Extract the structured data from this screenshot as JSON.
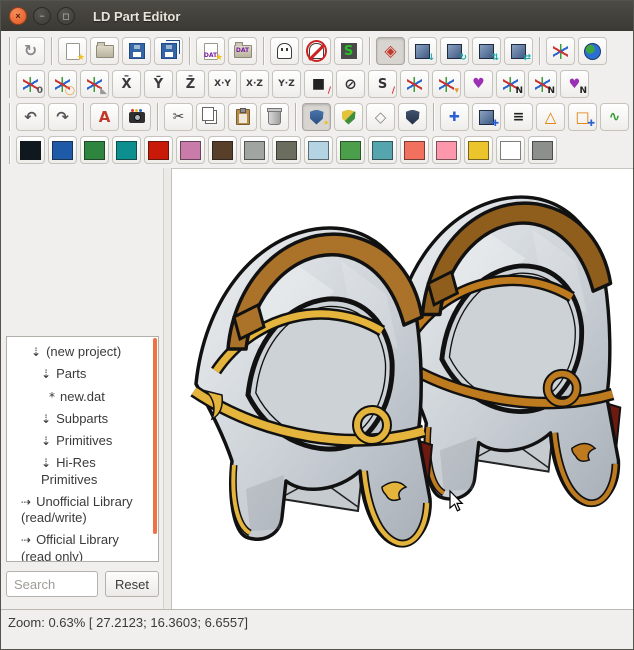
{
  "window": {
    "title": "LD Part Editor",
    "controls": [
      {
        "name": "close",
        "glyph": "×"
      },
      {
        "name": "minimize",
        "glyph": "−"
      },
      {
        "name": "maximize",
        "glyph": "◻"
      }
    ]
  },
  "toolbars": {
    "rows": [
      {
        "name": "toolbar-row-file",
        "items": [
          {
            "sep": true
          },
          {
            "name": "sync",
            "glyph": "↻",
            "color": "#8a8a8a",
            "size": 16
          },
          {
            "sep": true
          },
          {
            "name": "new-project",
            "kind": "page",
            "badge": "★",
            "badge_color": "#f0c020"
          },
          {
            "name": "open-project",
            "kind": "folder"
          },
          {
            "name": "save",
            "kind": "floppy"
          },
          {
            "name": "save-all",
            "kind": "floppy2"
          },
          {
            "sep": true
          },
          {
            "name": "new-dat-file",
            "kind": "page",
            "glyph": "DAT",
            "badge": "★",
            "badge_color": "#f0c020"
          },
          {
            "name": "open-dat-file",
            "kind": "folder",
            "glyph": "DAT"
          },
          {
            "sep": true
          },
          {
            "name": "show-ghost",
            "kind": "ghost"
          },
          {
            "name": "hide-ghost",
            "kind": "ghostno"
          },
          {
            "name": "swap-winding",
            "kind": "smode",
            "glyph": "S"
          },
          {
            "sep": true
          },
          {
            "name": "select-mode",
            "glyph": "◈",
            "color": "#c0392b",
            "size": 16,
            "pressed": true
          },
          {
            "name": "move-mode",
            "kind": "cube",
            "badge": "↓",
            "badge_color": "#18a8a8"
          },
          {
            "name": "rotate-mode",
            "kind": "cube",
            "badge": "↻",
            "badge_color": "#18a8a8"
          },
          {
            "name": "scale-mode",
            "kind": "cube",
            "badge": "⇅",
            "badge_color": "#18a8a8"
          },
          {
            "name": "combined-mode",
            "kind": "cube",
            "badge": "⇄",
            "badge_color": "#18a8a8"
          },
          {
            "sep": true
          },
          {
            "name": "local-axes",
            "kind": "axes3"
          },
          {
            "name": "global-axes",
            "kind": "globe"
          }
        ]
      },
      {
        "name": "toolbar-row-manipulator",
        "items": [
          {
            "sep": true
          },
          {
            "name": "manipulator-to-origin",
            "kind": "axes3",
            "badge": "0",
            "badge_color": "#555"
          },
          {
            "name": "manipulator-to-world",
            "kind": "axes3",
            "badge": "◯",
            "badge_color": "#e8912a"
          },
          {
            "name": "manipulator-to-surface",
            "kind": "axes3",
            "badge": "◣",
            "badge_color": "#9a9a9a"
          },
          {
            "name": "manipulator-x",
            "glyph": "X̄",
            "color": "#3a3a3a",
            "size": 13
          },
          {
            "name": "manipulator-y",
            "glyph": "Ȳ",
            "color": "#3a3a3a",
            "size": 13
          },
          {
            "name": "manipulator-z",
            "glyph": "Z̄",
            "color": "#3a3a3a",
            "size": 13
          },
          {
            "name": "manipulator-xy",
            "glyph": "X·Y",
            "color": "#3a3a3a",
            "size": 9
          },
          {
            "name": "manipulator-xz",
            "glyph": "X·Z",
            "color": "#3a3a3a",
            "size": 9
          },
          {
            "name": "manipulator-yz",
            "glyph": "Y·Z",
            "color": "#3a3a3a",
            "size": 9
          },
          {
            "name": "manipulator-camera",
            "glyph": "■",
            "color": "#222222",
            "size": 14,
            "badge": "/",
            "badge_color": "#c33"
          },
          {
            "name": "manipulator-lock",
            "glyph": "⊘",
            "color": "#333333",
            "size": 15
          },
          {
            "name": "manipulator-subfile",
            "glyph": "S",
            "color": "#333333",
            "size": 13,
            "badge": "/",
            "badge_color": "#c33"
          },
          {
            "name": "manipulator-vertex",
            "kind": "axes3"
          },
          {
            "name": "manipulator-edge",
            "kind": "axes3",
            "badge": "▾",
            "badge_color": "#e8912a"
          },
          {
            "name": "manipulator-face",
            "glyph": "♥",
            "color": "#9b30b5",
            "size": 14
          },
          {
            "name": "manipulator-vertex-n",
            "kind": "axes3",
            "badge": "N",
            "badge_color": "#222"
          },
          {
            "name": "manipulator-edge-n",
            "kind": "axes3",
            "badge": "N",
            "badge_color": "#222"
          },
          {
            "name": "manipulator-face-n",
            "glyph": "♥",
            "color": "#9b30b5",
            "size": 13,
            "badge": "N",
            "badge_color": "#222"
          }
        ]
      },
      {
        "name": "toolbar-row-edit",
        "items": [
          {
            "sep": true
          },
          {
            "name": "undo",
            "glyph": "↶",
            "color": "#555555",
            "size": 15
          },
          {
            "name": "redo",
            "glyph": "↷",
            "color": "#555555",
            "size": 15
          },
          {
            "sep": true
          },
          {
            "name": "measure",
            "glyph": "A",
            "color": "#c0392b",
            "size": 15
          },
          {
            "name": "snapshot",
            "kind": "camera"
          },
          {
            "sep": true
          },
          {
            "name": "cut",
            "glyph": "✂",
            "color": "#444444",
            "size": 14
          },
          {
            "name": "copy",
            "kind": "copy"
          },
          {
            "name": "paste",
            "kind": "paste"
          },
          {
            "name": "delete",
            "kind": "trash"
          },
          {
            "sep": true
          },
          {
            "name": "select-filter",
            "kind": "shield",
            "bg": "linear-gradient(#4a74ac,#274e7e)",
            "badge": "•",
            "badge_color": "#f0c020",
            "pressed": true
          },
          {
            "name": "select-same-color",
            "kind": "shield",
            "bg": "linear-gradient(135deg,#e3c23c 45%,#3d8f3d 50%)"
          },
          {
            "name": "select-wireframe",
            "glyph": "◇",
            "color": "#888888",
            "size": 15
          },
          {
            "name": "select-solid",
            "kind": "shield",
            "bg": "linear-gradient(#41546e,#222f44)"
          },
          {
            "sep": true
          },
          {
            "name": "add-vertex",
            "glyph": "✚",
            "color": "#2a62d4",
            "size": 13
          },
          {
            "name": "add-subfile",
            "kind": "cube",
            "badge": "✚",
            "badge_color": "#2a62d4"
          },
          {
            "name": "add-line",
            "glyph": "≡",
            "color": "#222222",
            "size": 14
          },
          {
            "name": "add-triangle",
            "glyph": "△",
            "color": "#e07b00",
            "size": 15
          },
          {
            "name": "add-quad",
            "glyph": "□",
            "color": "#e07b00",
            "size": 15,
            "badge": "✚",
            "badge_color": "#2a62d4"
          },
          {
            "name": "add-condline",
            "glyph": "∿",
            "color": "#3a9c3a",
            "size": 14
          }
        ]
      },
      {
        "name": "toolbar-row-palette",
        "items": [
          {
            "sep": true
          },
          {
            "name": "palette-0-black",
            "kind": "swatch",
            "bg": "#10181f"
          },
          {
            "name": "palette-1-blue",
            "kind": "swatch",
            "bg": "#1e5aa8"
          },
          {
            "name": "palette-2-green",
            "kind": "swatch",
            "bg": "#2e8540"
          },
          {
            "name": "palette-3-teal",
            "kind": "swatch",
            "bg": "#0e8f8f"
          },
          {
            "name": "palette-4-red",
            "kind": "swatch",
            "bg": "#c91a09"
          },
          {
            "name": "palette-5-dark-pink",
            "kind": "swatch",
            "bg": "#c97caa"
          },
          {
            "name": "palette-6-brown",
            "kind": "swatch",
            "bg": "#573f2a"
          },
          {
            "name": "palette-7-light-gray",
            "kind": "swatch",
            "bg": "#a0a5a2"
          },
          {
            "name": "palette-8-dark-gray",
            "kind": "swatch",
            "bg": "#6b6e5f"
          },
          {
            "name": "palette-9-light-blue",
            "kind": "swatch",
            "bg": "#b4d4e3"
          },
          {
            "name": "palette-10-bright-green",
            "kind": "swatch",
            "bg": "#4b9f4a"
          },
          {
            "name": "palette-11-turquoise",
            "kind": "swatch",
            "bg": "#55a5af"
          },
          {
            "name": "palette-12-salmon",
            "kind": "swatch",
            "bg": "#f2705e"
          },
          {
            "name": "palette-13-pink",
            "kind": "swatch",
            "bg": "#fc97ac"
          },
          {
            "name": "palette-14-yellow",
            "kind": "swatch",
            "bg": "#ecc52c"
          },
          {
            "name": "palette-15-white",
            "kind": "swatch",
            "bg": "#ffffff"
          },
          {
            "name": "palette-16-main-gray",
            "kind": "swatch",
            "bg": "#8c8f8c"
          }
        ]
      }
    ]
  },
  "sidebar": {
    "tree_icons": {
      "expanded": "⇣",
      "collapsed": "⇢",
      "modified": "*"
    },
    "tree": [
      {
        "label": "(new project)",
        "state": "expanded",
        "indent": 1
      },
      {
        "label": "Parts",
        "state": "expanded",
        "indent": 2
      },
      {
        "label": "new.dat",
        "state": "modified",
        "indent": 3
      },
      {
        "label": "Subparts",
        "state": "expanded",
        "indent": 2
      },
      {
        "label": "Primitives",
        "state": "expanded",
        "indent": 2
      },
      {
        "label": "Hi-Res Primitives",
        "state": "expanded",
        "indent": 2
      },
      {
        "label": "Unofficial Library (read/write)",
        "state": "collapsed",
        "indent": 0
      },
      {
        "label": "Official Library (read only)",
        "state": "collapsed",
        "indent": 0
      }
    ],
    "search": {
      "placeholder": "Search",
      "value": ""
    },
    "reset_label": "Reset"
  },
  "viewport": {
    "background": "#ffffff",
    "models": [
      {
        "name": "helmet-left",
        "trim": "#e4b43c",
        "crest": "#ab722a",
        "steel": "#ccd2d8"
      },
      {
        "name": "helmet-right",
        "trim": "#bd7a1e",
        "crest": "#8f5e1c",
        "steel": "#c4cad2"
      }
    ]
  },
  "statusbar": {
    "text": "Zoom: 0.63% [ 27.2123; 16.3603; 6.6557]"
  }
}
